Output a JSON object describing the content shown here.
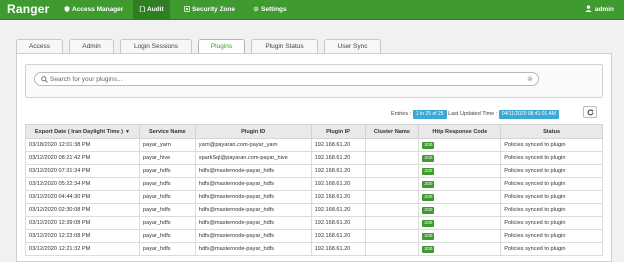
{
  "navbar": {
    "brand": "Ranger",
    "items": [
      {
        "label": "Access Manager",
        "icon": "shield-icon"
      },
      {
        "label": "Audit",
        "icon": "file-icon",
        "active": true
      },
      {
        "label": "Security Zone",
        "icon": "zone-icon"
      },
      {
        "label": "Settings",
        "icon": "gear-icon"
      }
    ],
    "user": "admin"
  },
  "tabs": [
    "Access",
    "Admin",
    "Login Sessions",
    "Plugins",
    "Plugin Status",
    "User Sync"
  ],
  "active_tab": "Plugins",
  "search": {
    "placeholder": "Search for your plugins..."
  },
  "meta": {
    "entries_label": "Entries :",
    "entries_value": "1 to 25 of 25",
    "updated_label": "Last Updated Time :",
    "updated_value": "04/11/2020 08:41:01 AM"
  },
  "table": {
    "columns": [
      "Export Date ( Iran Daylight Time )",
      "Service Name",
      "Plugin ID",
      "Plugin IP",
      "Cluster Name",
      "Http Response Code",
      "Status"
    ],
    "rows": [
      [
        "03/18/2020 12:01:38 PM",
        "payar_yarn",
        "yarn@payaran.com-payar_yarn",
        "192.168.61.20",
        "",
        "200",
        "Policies synced to plugin"
      ],
      [
        "03/12/2020 08:21:42 PM",
        "payar_hive",
        "sparkSql@payaran.com-payar_hive",
        "192.168.61.20",
        "",
        "200",
        "Policies synced to plugin"
      ],
      [
        "03/12/2020 07:31:34 PM",
        "payar_hdfs",
        "hdfs@masternode-payar_hdfs",
        "192.168.61.20",
        "",
        "200",
        "Policies synced to plugin"
      ],
      [
        "03/12/2020 05:22:34 PM",
        "payar_hdfs",
        "hdfs@masternode-payar_hdfs",
        "192.168.61.20",
        "",
        "200",
        "Policies synced to plugin"
      ],
      [
        "03/12/2020 04:44:30 PM",
        "payar_hdfs",
        "hdfs@masternode-payar_hdfs",
        "192.168.61.20",
        "",
        "200",
        "Policies synced to plugin"
      ],
      [
        "03/12/2020 02:30:08 PM",
        "payar_hdfs",
        "hdfs@masternode-payar_hdfs",
        "192.168.61.20",
        "",
        "200",
        "Policies synced to plugin"
      ],
      [
        "03/12/2020 12:39:08 PM",
        "payar_hdfs",
        "hdfs@masternode-payar_hdfs",
        "192.168.61.20",
        "",
        "200",
        "Policies synced to plugin"
      ],
      [
        "03/12/2020 12:23:08 PM",
        "payar_hdfs",
        "hdfs@masternode-payar_hdfs",
        "192.168.61.20",
        "",
        "200",
        "Policies synced to plugin"
      ],
      [
        "03/12/2020 12:21:32 PM",
        "payar_hdfs",
        "hdfs@masternode-payar_hdfs",
        "192.168.61.20",
        "",
        "200",
        "Policies synced to plugin"
      ]
    ]
  },
  "colors": {
    "brand_green": "#3f9a2f",
    "badge_blue": "#3aa8d8"
  }
}
